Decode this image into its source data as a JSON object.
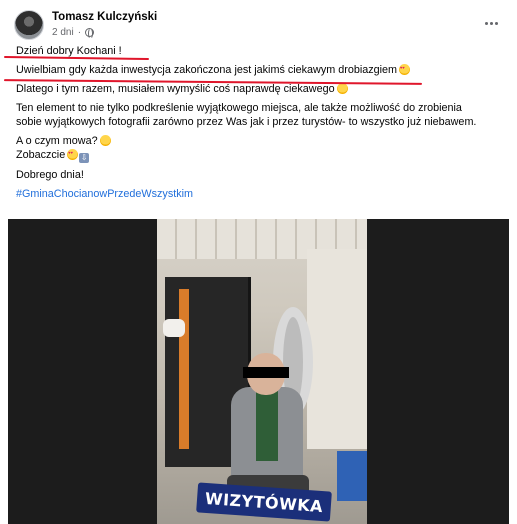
{
  "post": {
    "author": "Tomasz Kulczyński",
    "time": "2 dni",
    "lines": {
      "l1": "Dzień dobry Kochani !",
      "l2": "Uwielbiam gdy każda inwestycja zakończona jest jakimś ciekawym drobiazgiem",
      "l3": "Dlatego i tym razem, musiałem wymyślić coś naprawdę ciekawego",
      "l4a": "Ten element to nie tylko podkreślenie wyjątkowego miejsca, ale także możliwość do zrobienia",
      "l4b": "sobie wyjątkowych fotografii zarówno przez Was jak i przez turystów- to wszystko już niebawem.",
      "l5": "A o czym mowa?",
      "l6": "Zobaczcie",
      "l7": "Dobrego dnia!",
      "hashtag": "#GminaChocianowPrzedeWszystkim"
    },
    "emoji": {
      "heart_eyes": "heart-eyes-emoji",
      "smile": "smiling-emoji",
      "thinking": "thinking-emoji",
      "arrow": "down-arrow-emoji"
    },
    "annotation_color": "#e0162b"
  },
  "media": {
    "banner_text": "WIZYTÓWKA"
  }
}
